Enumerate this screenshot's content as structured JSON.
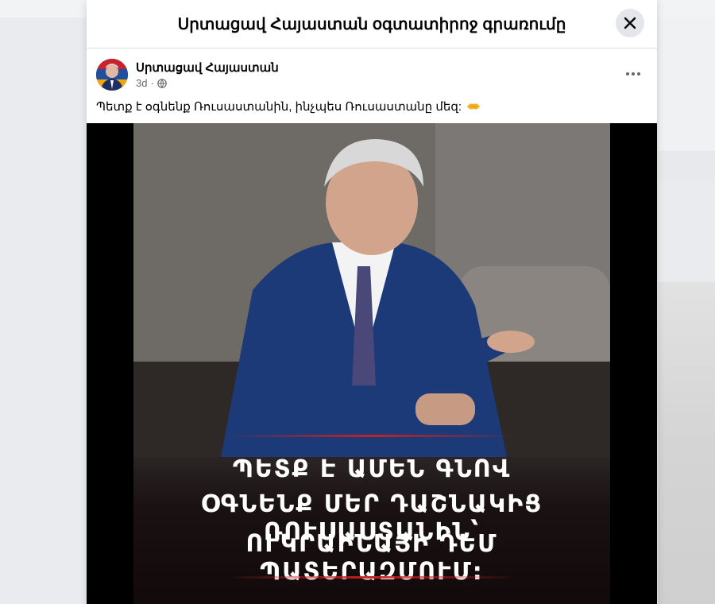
{
  "modal": {
    "title": "Սրտացավ Հայաստան օգտատիրոջ գրառումը",
    "close_label": "Close"
  },
  "post": {
    "author": "Սրտացավ Հայաստան",
    "time": "3d",
    "separator": "·",
    "privacy_icon": "globe-icon",
    "text": "Պետք է օգնենք Ռուսաստանին, ինչպես Ռուսաստանը մեզ:",
    "emoji": "handshake-emoji",
    "image_caption": {
      "line1": "ՊԵՏՔ Է ԱՄԵՆ ԳՆՈՎ",
      "line2": "ՕԳՆԵՆՔ ՄԵՐ ԴԱՇՆԱԿԻՑ ՌՈՒՍԱՍՏԱՆԻՆ՝",
      "line3": "ՈՒԿՐԱԻՆԱՅԻ ԴԵՄ ՊԱՏԵՐԱԶՄՈՒՄ:"
    }
  },
  "colors": {
    "accent_red": "#c92020",
    "text_primary": "#050505",
    "text_secondary": "#65676b"
  }
}
